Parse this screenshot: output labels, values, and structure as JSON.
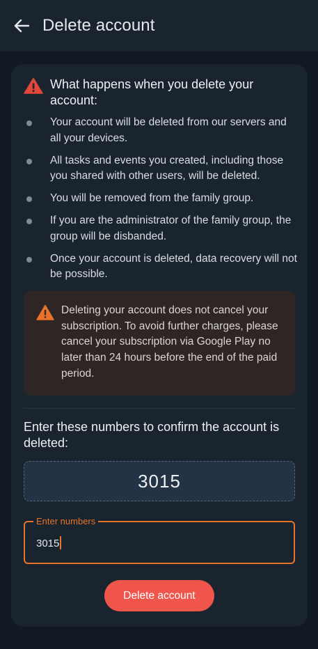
{
  "appbar": {
    "title": "Delete account",
    "back_icon": "arrow-left-icon"
  },
  "warning": {
    "title": "What happens when you delete your account:",
    "icon": "warning-triangle-icon",
    "items": [
      "Your account will be deleted from our servers and all your devices.",
      "All tasks and events you created, including those you shared with other users, will be deleted.",
      "You will be removed from the family group.",
      "If you are the administrator of the family group, the group will be disbanded.",
      "Once your account is deleted, data recovery will not be possible."
    ]
  },
  "notice": {
    "icon": "warning-triangle-icon",
    "text": "Deleting your account does not cancel your subscription. To avoid further charges, please cancel your subscription via Google Play no later than 24 hours before the end of the paid period."
  },
  "confirm": {
    "label": "Enter these numbers to confirm the account is deleted:",
    "code": "3015",
    "field_label": "Enter numbers",
    "field_value": "3015"
  },
  "actions": {
    "delete_label": "Delete account"
  },
  "colors": {
    "background": "#111a22",
    "card": "#19242e",
    "warning": "#e2473b",
    "notice_icon": "#e8732a",
    "accent": "#e8732a",
    "danger_button": "#f0554b"
  }
}
